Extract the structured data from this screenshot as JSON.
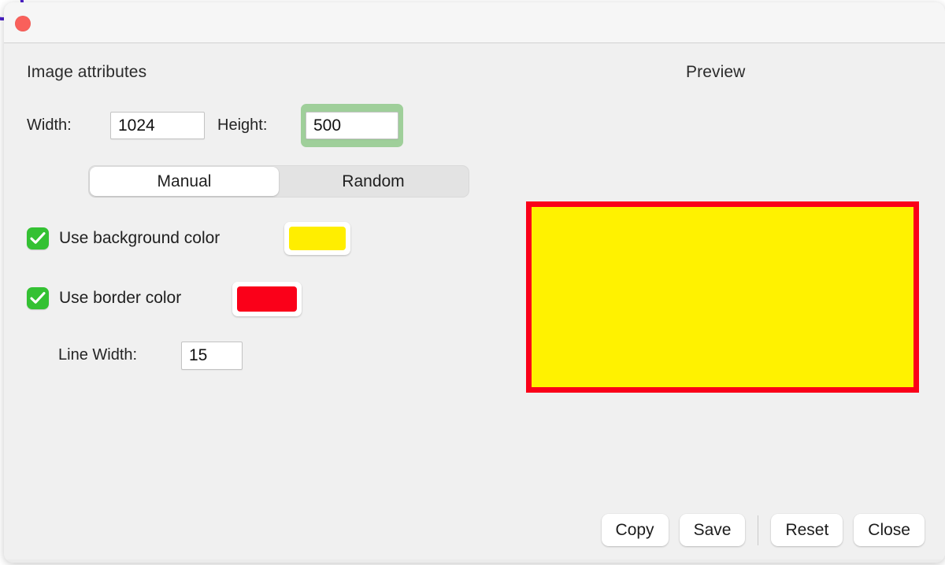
{
  "window": {
    "close_button": "close",
    "titlebar_color": "#f6f6f6",
    "body_color": "#f0f0f0"
  },
  "attributes_panel": {
    "heading": "Image attributes",
    "width": {
      "label": "Width:",
      "value": "1024"
    },
    "height": {
      "label": "Height:",
      "value": "500",
      "focused": true,
      "focus_ring_color": "#9fcf9a"
    },
    "mode_segments": [
      {
        "label": "Manual",
        "selected": true
      },
      {
        "label": "Random",
        "selected": false
      }
    ],
    "background_color_option": {
      "label": "Use background color",
      "checked": true,
      "swatch_color": "#ffee00"
    },
    "border_color_option": {
      "label": "Use border color",
      "checked": true,
      "swatch_color": "#fa0019"
    },
    "line_width": {
      "label": "Line Width:",
      "value": "15"
    },
    "checkbox_color": "#34c133"
  },
  "preview_panel": {
    "heading": "Preview",
    "fill_color": "#fff200",
    "border_color": "#fa0019",
    "border_width_px": "7"
  },
  "footer": {
    "buttons": [
      {
        "label": "Copy"
      },
      {
        "label": "Save"
      },
      {
        "label": "Reset"
      },
      {
        "label": "Close"
      }
    ]
  }
}
